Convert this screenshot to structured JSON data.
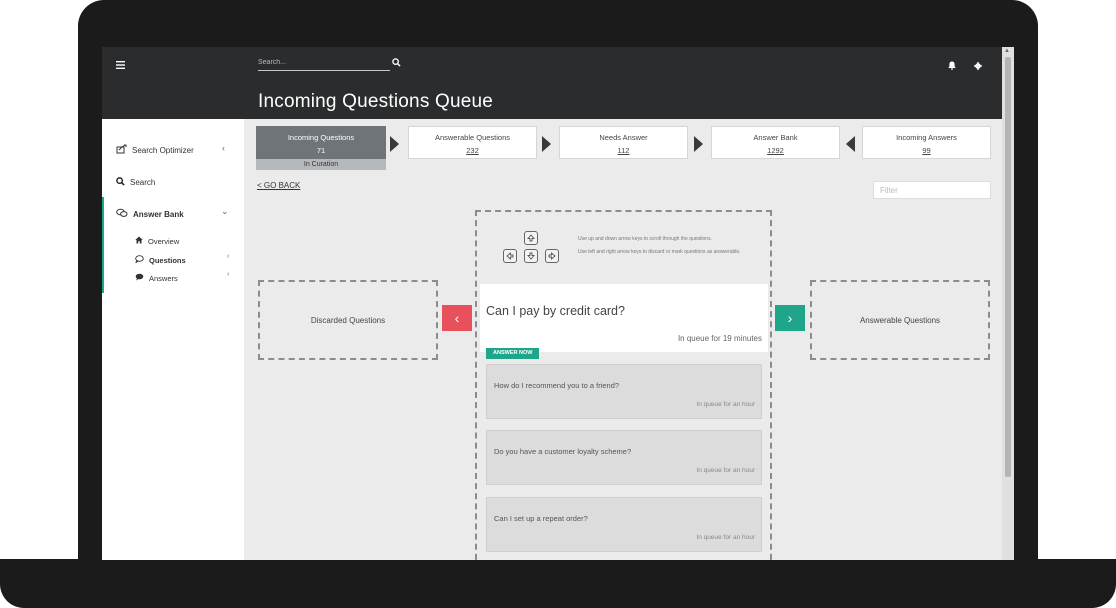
{
  "header": {
    "search_placeholder": "Search...",
    "page_title": "Incoming Questions Queue"
  },
  "sidebar": {
    "items": [
      {
        "label": "Search Optimizer",
        "icon": "search-optimizer-icon"
      },
      {
        "label": "Search",
        "icon": "search-icon"
      },
      {
        "label": "Answer Bank",
        "icon": "chat-bubbles-icon"
      }
    ],
    "subitems": [
      {
        "label": "Overview",
        "icon": "home-icon"
      },
      {
        "label": "Questions",
        "icon": "speech-bubble-outline-icon"
      },
      {
        "label": "Answers",
        "icon": "speech-bubble-filled-icon"
      }
    ]
  },
  "pipeline": {
    "steps": [
      {
        "label": "Incoming Questions",
        "count": "71"
      },
      {
        "label": "Answerable Questions",
        "count": "232"
      },
      {
        "label": "Needs Answer",
        "count": "112"
      },
      {
        "label": "Answer Bank",
        "count": "1292"
      },
      {
        "label": "Incoming Answers",
        "count": "99"
      }
    ],
    "active_sub": "In Curation"
  },
  "toolbar": {
    "go_back": "GO BACK",
    "filter_placeholder": "Filter"
  },
  "help": {
    "line1": "Use up and down arrow keys to scroll through the questions.",
    "line2": "Use left and right arrow keys to discard or mark questions as answerable."
  },
  "discarded_label": "Discarded Questions",
  "answerable_label": "Answerable Questions",
  "current_question": {
    "text": "Can I pay by credit card?",
    "queue_time": "In queue for 19 minutes",
    "answer_button": "ANSWER NOW"
  },
  "queue": [
    {
      "text": "How do I recommend you to a friend?",
      "time": "In queue for an hour"
    },
    {
      "text": "Do you have a customer loyalty scheme?",
      "time": "In queue for an hour"
    },
    {
      "text": "Can I set up a repeat order?",
      "time": "In queue for an hour"
    }
  ],
  "colors": {
    "accent": "#1ea58a",
    "discard": "#e8505b",
    "header": "#2a2c2d"
  }
}
